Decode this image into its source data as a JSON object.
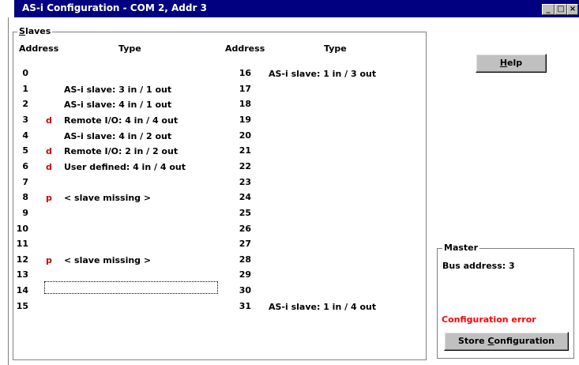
{
  "window": {
    "title": "AS-i Configuration - COM 2, Addr 3",
    "min_glyph": "_",
    "max_glyph": "□",
    "close_glyph": "×"
  },
  "slaves": {
    "group_label_accel": "S",
    "group_label_rest": "laves",
    "col_address": "Address",
    "col_type": "Type",
    "left": [
      {
        "addr": "0",
        "flag": "",
        "type": ""
      },
      {
        "addr": "1",
        "flag": "",
        "type": "AS-i slave: 3 in / 1 out"
      },
      {
        "addr": "2",
        "flag": "",
        "type": "AS-i slave: 4 in / 1 out"
      },
      {
        "addr": "3",
        "flag": "d",
        "type": "Remote I/O: 4 in / 4 out"
      },
      {
        "addr": "4",
        "flag": "",
        "type": "AS-i slave: 4 in / 2 out"
      },
      {
        "addr": "5",
        "flag": "d",
        "type": "Remote I/O: 2 in / 2 out"
      },
      {
        "addr": "6",
        "flag": "d",
        "type": "User defined: 4 in / 4 out"
      },
      {
        "addr": "7",
        "flag": "",
        "type": ""
      },
      {
        "addr": "8",
        "flag": "p",
        "type": "< slave missing >"
      },
      {
        "addr": "9",
        "flag": "",
        "type": ""
      },
      {
        "addr": "10",
        "flag": "",
        "type": ""
      },
      {
        "addr": "11",
        "flag": "",
        "type": ""
      },
      {
        "addr": "12",
        "flag": "p",
        "type": "< slave missing >"
      },
      {
        "addr": "13",
        "flag": "",
        "type": ""
      },
      {
        "addr": "14",
        "flag": "",
        "type": ""
      },
      {
        "addr": "15",
        "flag": "",
        "type": ""
      }
    ],
    "right": [
      {
        "addr": "16",
        "flag": "",
        "type": "AS-i slave: 1 in / 3 out"
      },
      {
        "addr": "17",
        "flag": "",
        "type": ""
      },
      {
        "addr": "18",
        "flag": "",
        "type": ""
      },
      {
        "addr": "19",
        "flag": "",
        "type": ""
      },
      {
        "addr": "20",
        "flag": "",
        "type": ""
      },
      {
        "addr": "21",
        "flag": "",
        "type": ""
      },
      {
        "addr": "22",
        "flag": "",
        "type": ""
      },
      {
        "addr": "23",
        "flag": "",
        "type": ""
      },
      {
        "addr": "24",
        "flag": "",
        "type": ""
      },
      {
        "addr": "25",
        "flag": "",
        "type": ""
      },
      {
        "addr": "26",
        "flag": "",
        "type": ""
      },
      {
        "addr": "27",
        "flag": "",
        "type": ""
      },
      {
        "addr": "28",
        "flag": "",
        "type": ""
      },
      {
        "addr": "29",
        "flag": "",
        "type": ""
      },
      {
        "addr": "30",
        "flag": "",
        "type": ""
      },
      {
        "addr": "31",
        "flag": "",
        "type": "AS-i slave: 1 in / 4 out"
      }
    ]
  },
  "help_button": {
    "accel": "H",
    "rest": "elp"
  },
  "master": {
    "group_label": "Master",
    "bus_address": "Bus address: 3",
    "error_text": "Configuration error",
    "error_color": "#ff0000",
    "store_prefix": "Store ",
    "store_accel": "C",
    "store_rest": "onfiguration"
  },
  "colors": {
    "titlebar": "#000080",
    "flag": "#cc0000"
  }
}
